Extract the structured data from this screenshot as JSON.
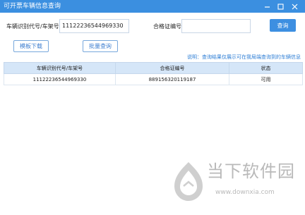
{
  "window": {
    "title": "可开票车辆信息查询",
    "buttons": {
      "minimize_icon": "minimize-icon",
      "maximize_icon": "maximize-icon",
      "close_icon": "close-icon"
    }
  },
  "form": {
    "vin_label": "车辆识别代号/车架号",
    "vin_value": "11122236544969330",
    "cert_label": "合格证编号",
    "cert_value": "",
    "query_button": "查询"
  },
  "toolbar": {
    "template_download": "模板下载",
    "batch_query": "批量查询"
  },
  "notice": "说明：查询结果仅展示可在我局端查询到的车辆信息",
  "table": {
    "headers": [
      "车辆识别代号/车架号",
      "合格证编号",
      "状态"
    ],
    "rows": [
      [
        "11122236544969330",
        "889156320119187",
        "可用"
      ]
    ]
  },
  "watermark": {
    "brand": "当下软件园",
    "url": "www.downxia.com"
  }
}
